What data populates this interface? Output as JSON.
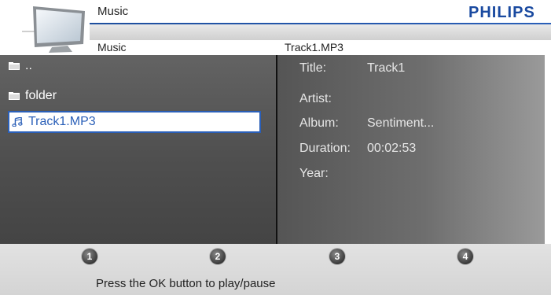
{
  "header": {
    "title": "Music",
    "brand": "PHILIPS",
    "icon": "tv-icon"
  },
  "subheader": {
    "left": "Music",
    "right": "Track1.MP3"
  },
  "browser": {
    "items": [
      {
        "label": "..",
        "icon": "folder-icon",
        "selected": false
      },
      {
        "label": "folder",
        "icon": "folder-icon",
        "selected": false
      },
      {
        "label": "Track1.MP3",
        "icon": "music-note-icon",
        "selected": true
      }
    ]
  },
  "info": {
    "fields": [
      {
        "label": "Title:",
        "value": "Track1"
      },
      {
        "label": "Artist:",
        "value": ""
      },
      {
        "label": "Album:",
        "value": "Sentiment..."
      },
      {
        "label": "Duration:",
        "value": "00:02:53"
      },
      {
        "label": "Year:",
        "value": ""
      }
    ]
  },
  "footer": {
    "buttons": [
      "1",
      "2",
      "3",
      "4"
    ],
    "hint": "Press the OK button to play/pause"
  },
  "colors": {
    "brand": "#1a4aa0",
    "selection": "#2a5fb8"
  }
}
